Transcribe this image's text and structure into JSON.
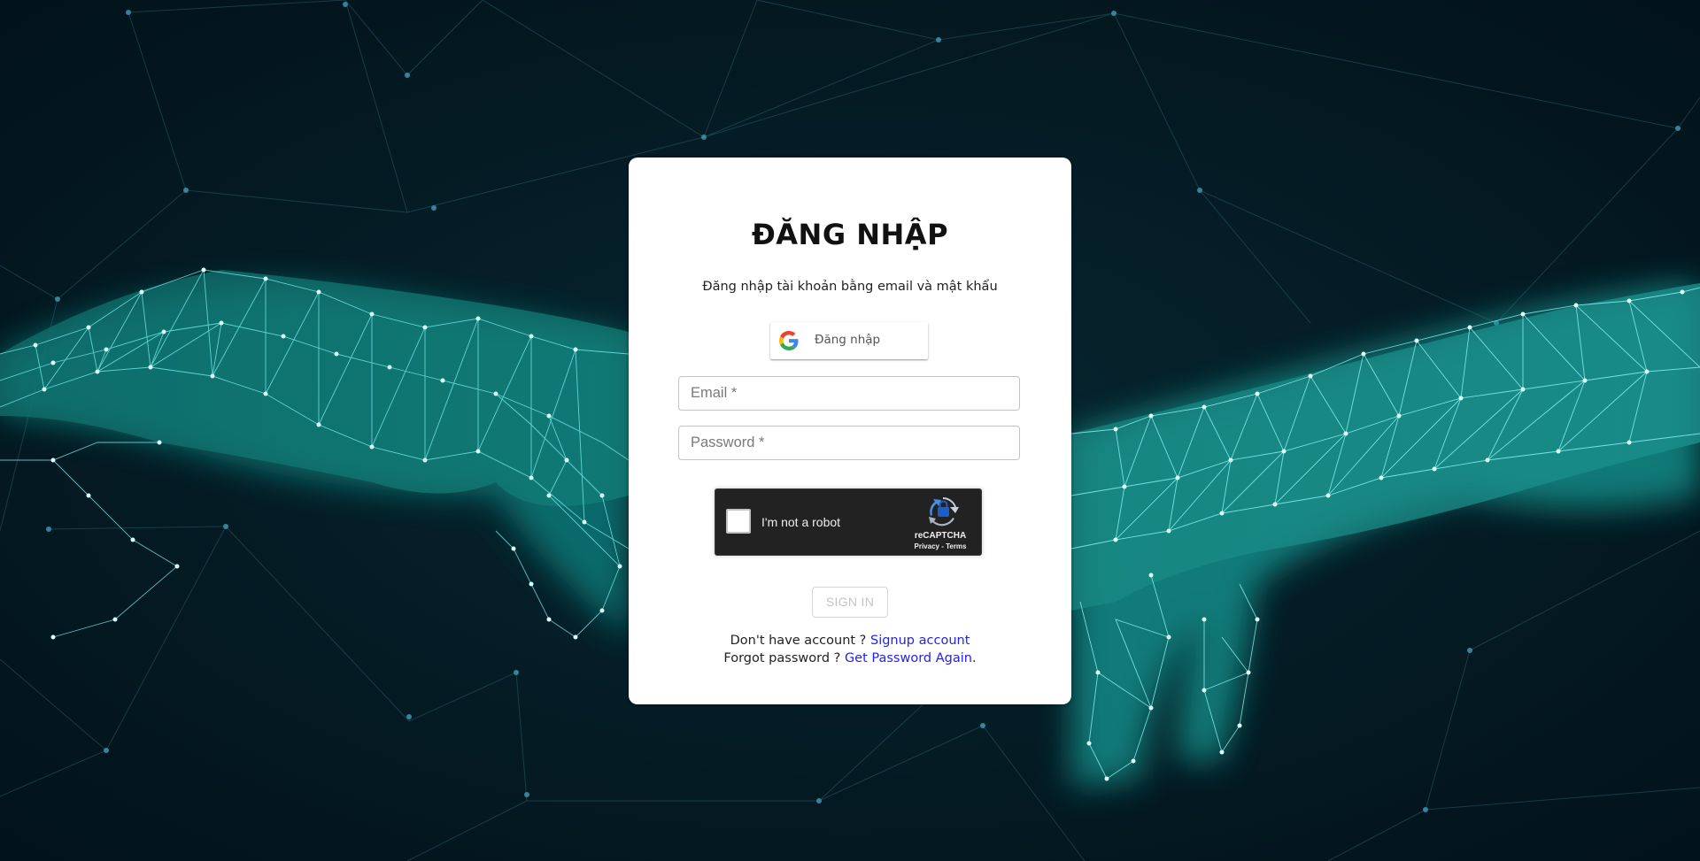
{
  "login": {
    "title": "ĐĂNG NHẬP",
    "subtitle": "Đăng nhập tài khoản bằng email và mật khẩu",
    "google_button_label": "Đăng nhập",
    "email_placeholder": "Email *",
    "password_placeholder": "Password *",
    "sign_in_label": "SIGN IN",
    "no_account_text": "Don't have account ? ",
    "signup_link": "Signup account",
    "forgot_text": "Forgot password ? ",
    "forgot_link": "Get Password Again",
    "forgot_suffix": "."
  },
  "recaptcha": {
    "label": "I'm not a robot",
    "brand": "reCAPTCHA",
    "privacy": "Privacy",
    "separator": " - ",
    "terms": "Terms"
  },
  "icons": {
    "google": "google-g-icon",
    "recaptcha": "recaptcha-logo-icon"
  },
  "colors": {
    "background": "#03151c",
    "network": "#2ee0e6",
    "card": "#ffffff",
    "link": "#2222ee",
    "recaptcha_bg": "#222222"
  }
}
